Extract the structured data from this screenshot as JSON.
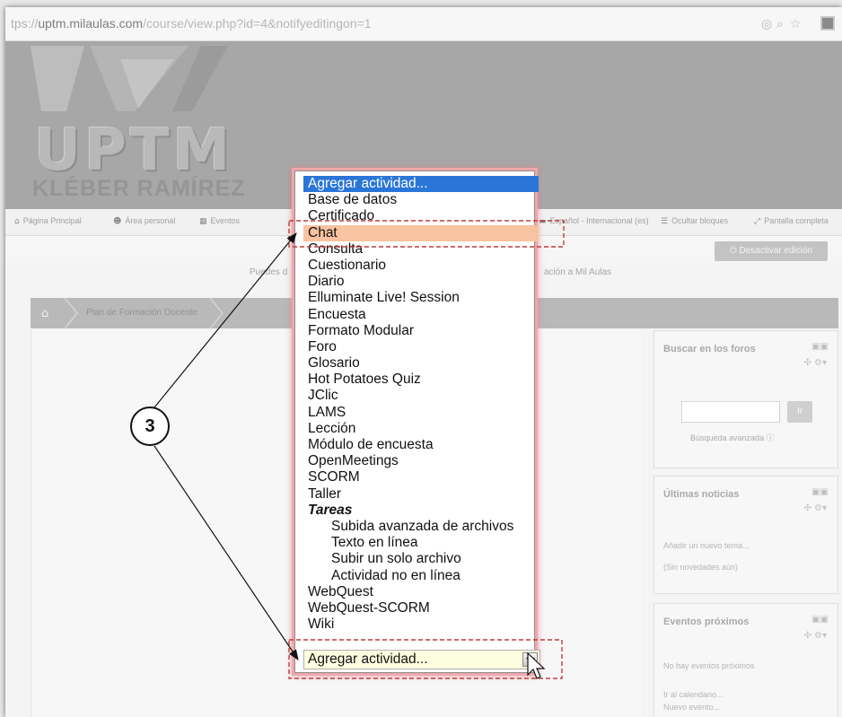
{
  "browser": {
    "url_prefix": "tps://",
    "url_host": "uptm.milaulas.com",
    "url_path": "/course/view.php?id=4&notifyeditingon=1"
  },
  "header": {
    "logo_text": "UPTM",
    "logo_subtext": "KLÉBER RAMÍREZ"
  },
  "nav": {
    "items": [
      {
        "icon": "home-icon",
        "label": "Página Principal"
      },
      {
        "icon": "user-area-icon",
        "label": "Área personal"
      },
      {
        "icon": "calendar-icon",
        "label": "Eventos"
      },
      {
        "icon": "language-icon",
        "label": "Español - Internacional (es)"
      },
      {
        "icon": "hide-blocks-icon",
        "label": "Ocultar bloques"
      },
      {
        "icon": "fullscreen-icon",
        "label": "Pantalla completa"
      }
    ]
  },
  "editbar": {
    "deactivate_label": "Desactivar edición"
  },
  "info": {
    "left": "Puedes d",
    "right": "ación a Mil Aulas"
  },
  "breadcrumb": {
    "item": "Plan de Formación Docente"
  },
  "blocks": {
    "search": {
      "title": "Buscar en los foros",
      "go_label": "Ir",
      "advanced_label": "Búsqueda avanzada"
    },
    "news": {
      "title": "Últimas noticias",
      "add_label": "Añadir un nuevo tema...",
      "empty_label": "(Sin novedades aún)"
    },
    "events": {
      "title": "Eventos próximos",
      "empty_label": "No hay eventos próximos",
      "calendar_label": "Ir al calendario...",
      "new_label": "Nuevo evento..."
    }
  },
  "activity_select": {
    "value": "Agregar actividad...",
    "options": [
      "Agregar actividad...",
      "Base de datos",
      "Certificado",
      "Chat",
      "Consulta",
      "Cuestionario",
      "Diario",
      "Elluminate Live! Session",
      "Encuesta",
      "Formato Modular",
      "Foro",
      "Glosario",
      "Hot Potatoes Quiz",
      "JClic",
      "LAMS",
      "Lección",
      "Módulo de encuesta",
      "OpenMeetings",
      "SCORM",
      "Taller",
      "Tareas",
      "Subida avanzada de archivos",
      "Texto en línea",
      "Subir un solo archivo",
      "Actividad no en línea",
      "WebQuest",
      "WebQuest-SCORM",
      "Wiki"
    ],
    "selected_index": 0,
    "highlighted_index": 3
  },
  "annotation": {
    "marker_label": "3"
  }
}
